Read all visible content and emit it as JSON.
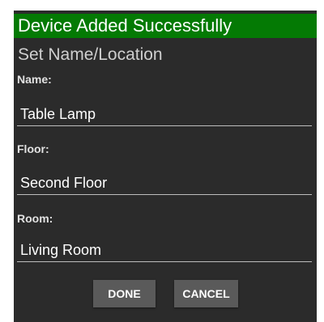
{
  "dialog": {
    "banner_text": "Device Added Successfully",
    "subtitle": "Set Name/Location",
    "fields": {
      "name": {
        "label": "Name:",
        "value": "Table Lamp"
      },
      "floor": {
        "label": "Floor:",
        "value": "Second Floor"
      },
      "room": {
        "label": "Room:",
        "value": "Living Room"
      }
    },
    "buttons": {
      "done_label": "DONE",
      "cancel_label": "CANCEL"
    }
  },
  "colors": {
    "banner_green": "#047a04",
    "dialog_background": "#2b2b2b",
    "button_background": "#5a5a5a"
  }
}
